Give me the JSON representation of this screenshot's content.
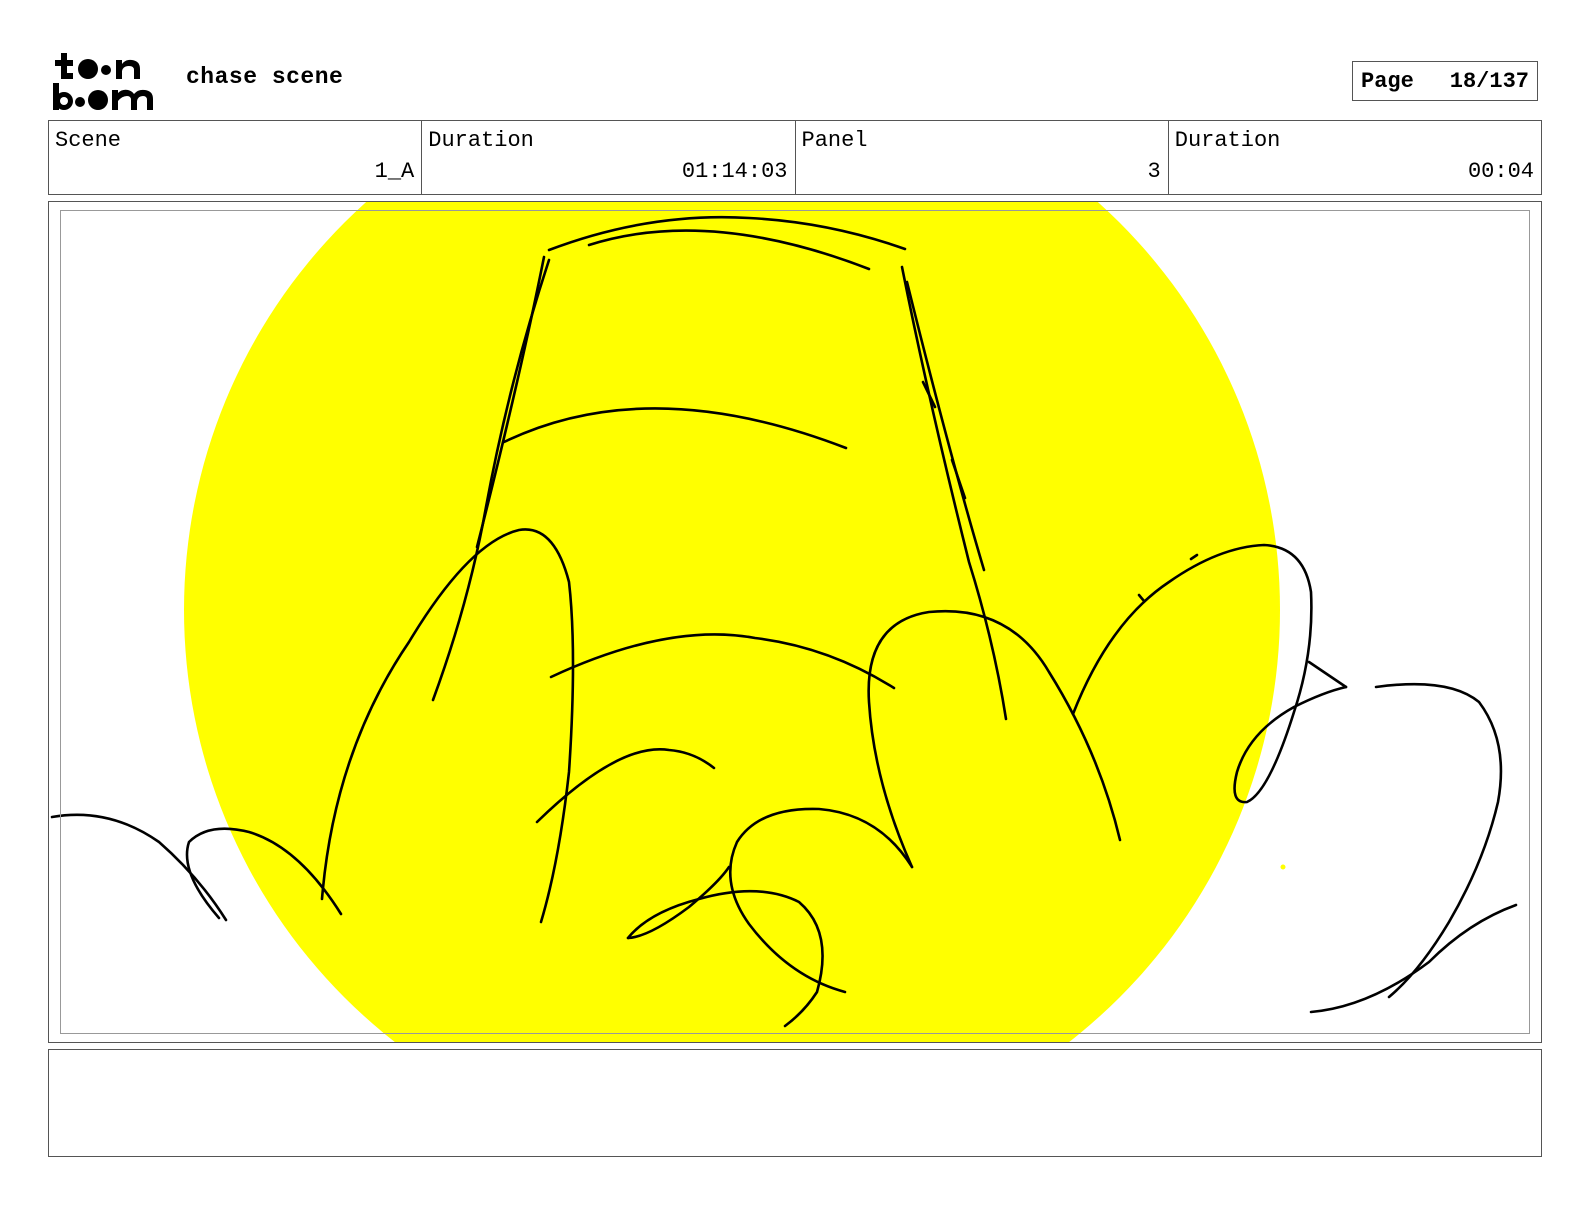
{
  "header": {
    "logo_text": "toon boom",
    "project_title": "chase scene",
    "page_label": "Page",
    "page_number": "18/137"
  },
  "info": {
    "scene_label": "Scene",
    "scene_value": "1_A",
    "scene_duration_label": "Duration",
    "scene_duration_value": "01:14:03",
    "panel_label": "Panel",
    "panel_value": "3",
    "panel_duration_label": "Duration",
    "panel_duration_value": "00:04"
  },
  "colors": {
    "sun": "#ffff00",
    "ink": "#000000",
    "frame": "#555555"
  },
  "notes": {
    "text": ""
  }
}
